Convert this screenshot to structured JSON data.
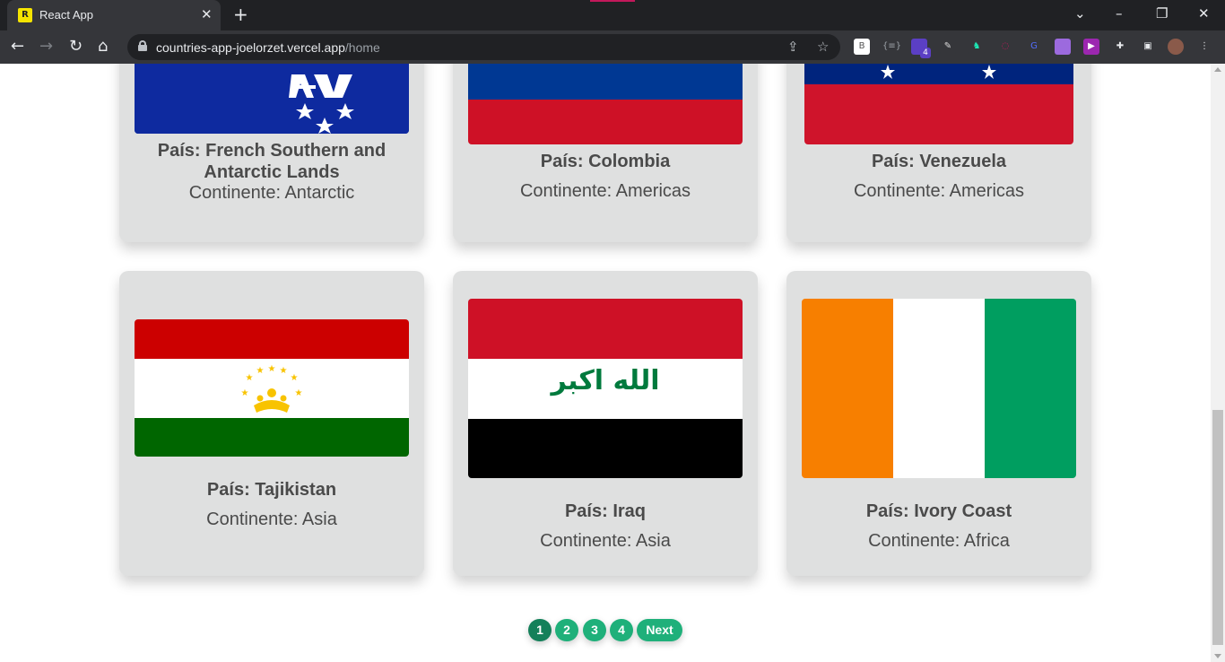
{
  "browser": {
    "tab_title": "React App",
    "tab_favicon": "R",
    "close_tab": "✕",
    "new_tab": "+",
    "url_host": "countries-app-joelorzet.vercel.app",
    "url_path": "/home",
    "ext_b": "B",
    "ext_badge": "4"
  },
  "cards": [
    {
      "country": "País: French Southern and Antarctic Lands",
      "continent": "Continente: Antarctic"
    },
    {
      "country": "País: Colombia",
      "continent": "Continente: Americas"
    },
    {
      "country": "País: Venezuela",
      "continent": "Continente: Americas"
    },
    {
      "country": "País: Tajikistan",
      "continent": "Continente: Asia"
    },
    {
      "country": "País: Iraq",
      "continent": "Continente: Asia"
    },
    {
      "country": "País: Ivory Coast",
      "continent": "Continente: Africa"
    }
  ],
  "flags": {
    "iraq_text": "الله اكبر"
  },
  "pagination": {
    "pages": [
      "1",
      "2",
      "3",
      "4"
    ],
    "next_label": "Next",
    "active_page": "1"
  },
  "colors": {
    "card_bg": "#dfe0e0",
    "pager_green": "#1fb07a",
    "pager_active": "#14805a"
  }
}
